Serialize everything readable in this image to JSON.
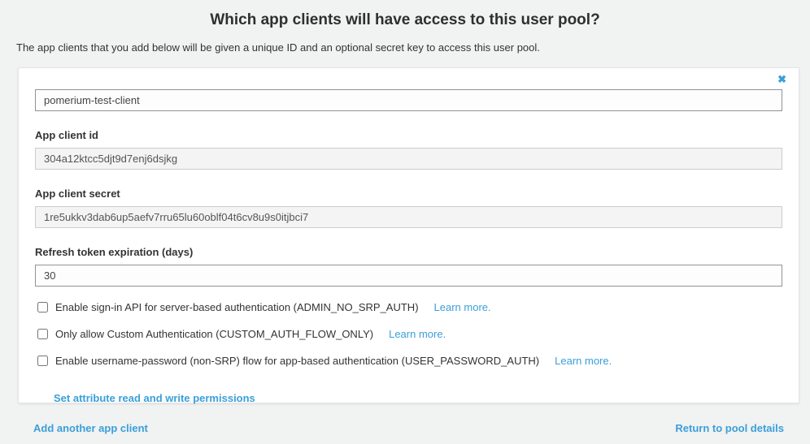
{
  "page": {
    "title": "Which app clients will have access to this user pool?",
    "subtitle": "The app clients that you add below will be given a unique ID and an optional secret key to access this user pool."
  },
  "card": {
    "close_glyph": "✖",
    "name_input": {
      "value": "pomerium-test-client"
    },
    "fields": [
      {
        "label": "App client id",
        "value": "304a12ktcc5djt9d7enj6dsjkg"
      },
      {
        "label": "App client secret",
        "value": "1re5ukkv3dab6up5aefv7rru65lu60oblf04t6cv8u9s0itjbci7"
      },
      {
        "label": "Refresh token expiration (days)",
        "value": "30"
      }
    ],
    "checkboxes": [
      {
        "label": "Enable sign-in API for server-based authentication (ADMIN_NO_SRP_AUTH)",
        "learn_more": "Learn more.",
        "checked": false
      },
      {
        "label": "Only allow Custom Authentication (CUSTOM_AUTH_FLOW_ONLY)",
        "learn_more": "Learn more.",
        "checked": false
      },
      {
        "label": "Enable username-password (non-SRP) flow for app-based authentication (USER_PASSWORD_AUTH)",
        "learn_more": "Learn more.",
        "checked": false
      }
    ],
    "permissions_link": "Set attribute read and write permissions"
  },
  "footer": {
    "add_link": "Add another app client",
    "return_link": "Return to pool details"
  },
  "colors": {
    "link_blue": "#3a9fd9",
    "page_background": "#f1f2f2",
    "card_background": "#ffffff"
  }
}
